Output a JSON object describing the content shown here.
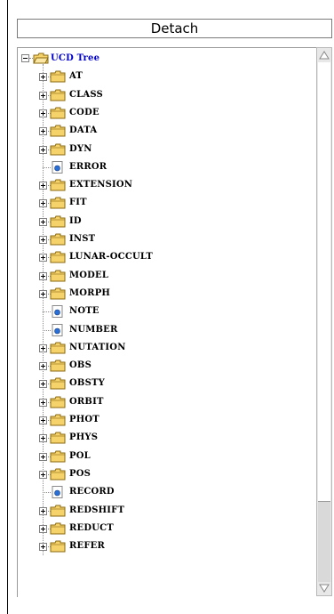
{
  "detach_label": "Detach",
  "tree": {
    "root": "UCD Tree",
    "items": [
      {
        "label": "AT",
        "type": "folder"
      },
      {
        "label": "CLASS",
        "type": "folder"
      },
      {
        "label": "CODE",
        "type": "folder"
      },
      {
        "label": "DATA",
        "type": "folder"
      },
      {
        "label": "DYN",
        "type": "folder"
      },
      {
        "label": "ERROR",
        "type": "leaf"
      },
      {
        "label": "EXTENSION",
        "type": "folder"
      },
      {
        "label": "FIT",
        "type": "folder"
      },
      {
        "label": "ID",
        "type": "folder"
      },
      {
        "label": "INST",
        "type": "folder"
      },
      {
        "label": "LUNAR-OCCULT",
        "type": "folder"
      },
      {
        "label": "MODEL",
        "type": "folder"
      },
      {
        "label": "MORPH",
        "type": "folder"
      },
      {
        "label": "NOTE",
        "type": "leaf"
      },
      {
        "label": "NUMBER",
        "type": "leaf"
      },
      {
        "label": "NUTATION",
        "type": "folder"
      },
      {
        "label": "OBS",
        "type": "folder"
      },
      {
        "label": "OBSTY",
        "type": "folder"
      },
      {
        "label": "ORBIT",
        "type": "folder"
      },
      {
        "label": "PHOT",
        "type": "folder"
      },
      {
        "label": "PHYS",
        "type": "folder"
      },
      {
        "label": "POL",
        "type": "folder"
      },
      {
        "label": "POS",
        "type": "folder"
      },
      {
        "label": "RECORD",
        "type": "leaf"
      },
      {
        "label": "REDSHIFT",
        "type": "folder"
      },
      {
        "label": "REDUCT",
        "type": "folder"
      },
      {
        "label": "REFER",
        "type": "folder"
      }
    ]
  },
  "colors": {
    "root_label": "#0000cc",
    "folder_fill": "#f5d26a",
    "folder_stroke": "#8a6a10",
    "leaf_dot": "#2a6fd6"
  }
}
